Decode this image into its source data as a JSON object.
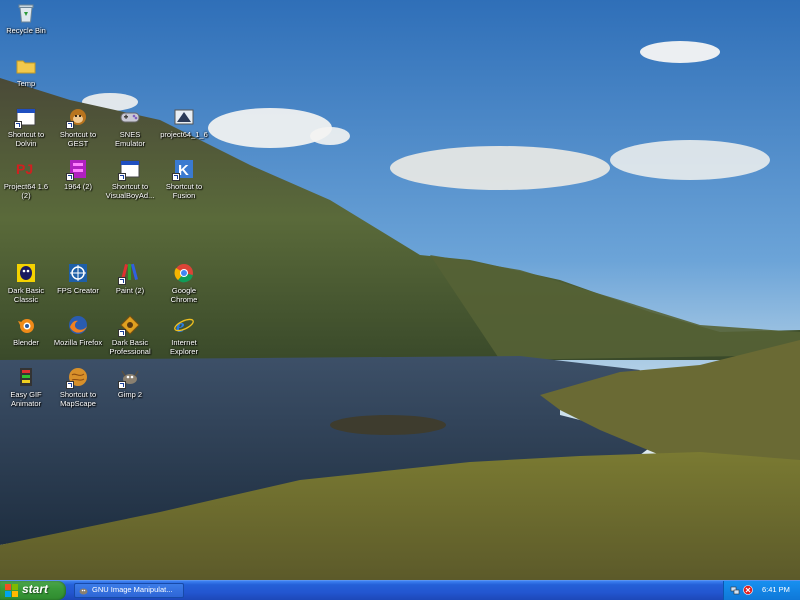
{
  "desktop": {
    "icons": [
      {
        "label": "Recycle Bin",
        "icon": "recycle-bin-icon"
      },
      {
        "label": "Temp",
        "icon": "folder-icon"
      },
      {
        "label": "Shortcut to Dolvin",
        "icon": "window-app-icon"
      },
      {
        "label": "Shortcut to GEST",
        "icon": "monkey-icon"
      },
      {
        "label": "SNES Emulator",
        "icon": "snes-controller-icon"
      },
      {
        "label": "project64_1_6",
        "icon": "project64-icon"
      },
      {
        "label": "Project64 1.6 (2)",
        "icon": "pj-logo-icon"
      },
      {
        "label": "1964 (2)",
        "icon": "emulator-1964-icon"
      },
      {
        "label": "Shortcut to VisualBoyAd...",
        "icon": "window-app-icon"
      },
      {
        "label": "Shortcut to Fusion",
        "icon": "fusion-k-icon"
      },
      {
        "label": "Dark Basic Classic",
        "icon": "dark-basic-icon"
      },
      {
        "label": "FPS Creator",
        "icon": "fps-creator-icon"
      },
      {
        "label": "Paint (2)",
        "icon": "paint-icon"
      },
      {
        "label": "Google Chrome",
        "icon": "chrome-icon"
      },
      {
        "label": "Blender",
        "icon": "blender-icon"
      },
      {
        "label": "Mozilla Firefox",
        "icon": "firefox-icon"
      },
      {
        "label": "Dark Basic Professional",
        "icon": "dark-basic-pro-icon"
      },
      {
        "label": "Internet Explorer",
        "icon": "internet-explorer-icon"
      },
      {
        "label": "Easy GIF Animator",
        "icon": "gif-animator-icon"
      },
      {
        "label": "Shortcut to MapScape",
        "icon": "mapscape-icon"
      },
      {
        "label": "Gimp 2",
        "icon": "gimp-icon"
      }
    ]
  },
  "taskbar": {
    "start_label": "start",
    "tasks": [
      {
        "label": "GNU Image Manipulat...",
        "icon": "gimp-icon"
      }
    ],
    "tray": {
      "icons": [
        "network-icon",
        "security-alert-icon"
      ],
      "clock": "6:41 PM"
    }
  },
  "colors": {
    "taskbar_blue": "#2356d0",
    "start_green": "#3a9a3a",
    "tray_blue": "#0f78d8"
  }
}
